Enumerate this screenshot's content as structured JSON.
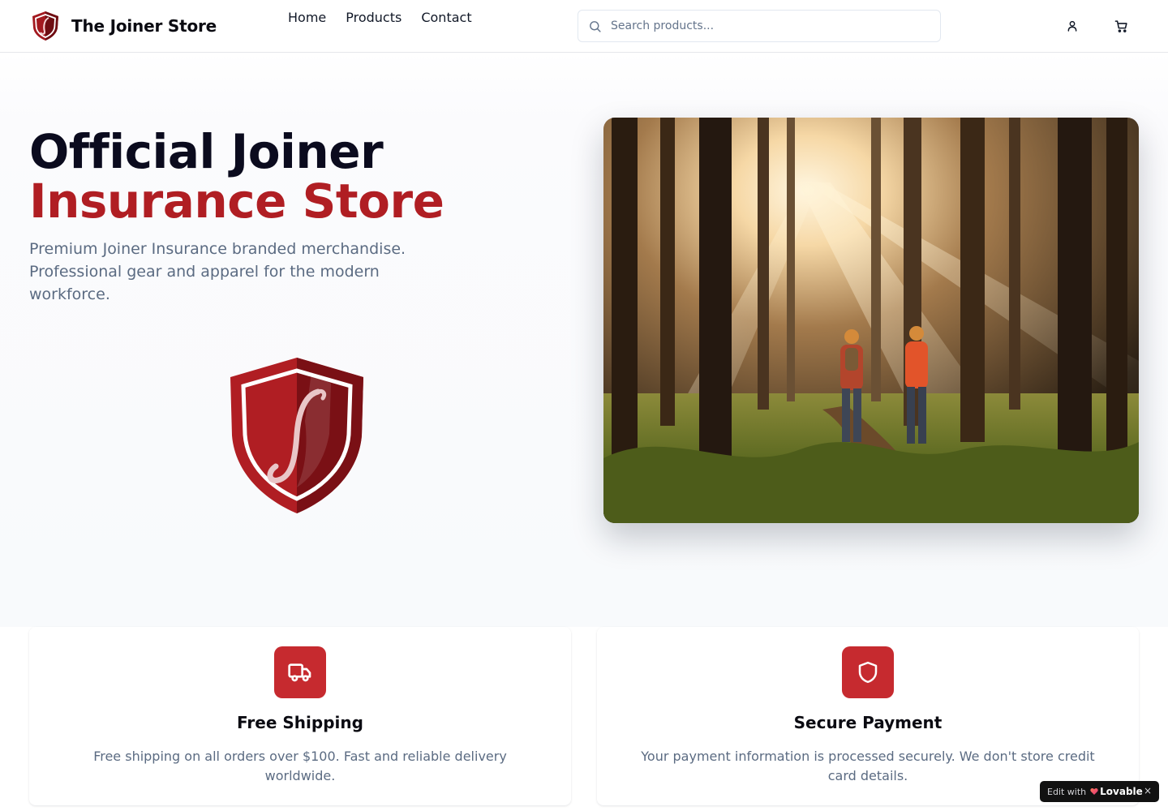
{
  "header": {
    "store_name": "The Joiner Store",
    "logo_icon": "joiner-shield-logo",
    "nav": [
      {
        "label": "Home"
      },
      {
        "label": "Products"
      },
      {
        "label": "Contact"
      }
    ],
    "search": {
      "placeholder": "Search products...",
      "value": "",
      "icon": "search-icon"
    },
    "user_icon": "user-icon",
    "cart_icon": "shopping-cart-icon"
  },
  "hero": {
    "title_line1": "Official Joiner",
    "title_line2": "Insurance Store",
    "subtitle": "Premium Joiner Insurance branded merchandise. Professional gear and apparel for the modern workforce.",
    "emblem_icon": "joiner-shield-emblem",
    "image_subject": "two workers in hard hats walking a forest trail in sunlight"
  },
  "features": [
    {
      "icon": "truck-icon",
      "title": "Free Shipping",
      "description": "Free shipping on all orders over $100. Fast and reliable delivery worldwide."
    },
    {
      "icon": "shield-icon",
      "title": "Secure Payment",
      "description": "Your payment information is processed securely. We don't store credit card details."
    }
  ],
  "badge": {
    "prefix": "Edit with",
    "brand": "Lovable",
    "close": "×"
  },
  "colors": {
    "brand_red": "#b01e23",
    "icon_red": "#c62a2f",
    "title_navy": "#0b0b1e",
    "muted_text": "#5b6b82",
    "border": "#e5e7eb"
  }
}
